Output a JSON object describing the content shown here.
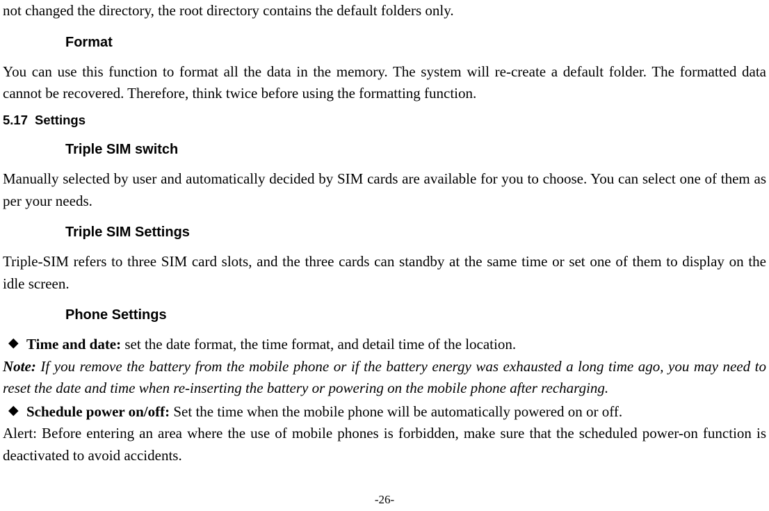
{
  "intro_fragment": "not changed the directory, the root directory contains the default folders only.",
  "h_format": "Format",
  "format_para": "You can use this function to format all the data in the memory. The system will re-create a default folder. The formatted data cannot be recovered. Therefore, think twice before using the formatting function.",
  "section_num": "5.17",
  "section_title": "Settings",
  "h_triple_switch": "Triple SIM switch",
  "triple_switch_para": "Manually selected by user and automatically decided by SIM cards are available for you to choose. You can select one of them as per your needs.",
  "h_triple_settings": "Triple SIM Settings",
  "triple_settings_para": "Triple-SIM refers to three SIM card slots, and the three cards can standby at the same time or set one of them to display on the idle screen.",
  "h_phone_settings": "Phone Settings",
  "bullet1_label": "Time and date:",
  "bullet1_text": " set the date format, the time format, and detail time of the location.",
  "note_label": "Note:",
  "note_text": " If you remove the battery from the mobile phone or if the battery energy was exhausted a long time ago, you may need to reset the date and time when re-inserting the battery or powering on the mobile phone after recharging.",
  "bullet2_label": "Schedule power on/off:",
  "bullet2_text": " Set the time when the mobile phone will be automatically powered on or off.",
  "alert_para": "Alert: Before entering an area where the use of mobile phones is forbidden, make sure that the scheduled power-on function is deactivated to avoid accidents.",
  "page_number": "-26-"
}
